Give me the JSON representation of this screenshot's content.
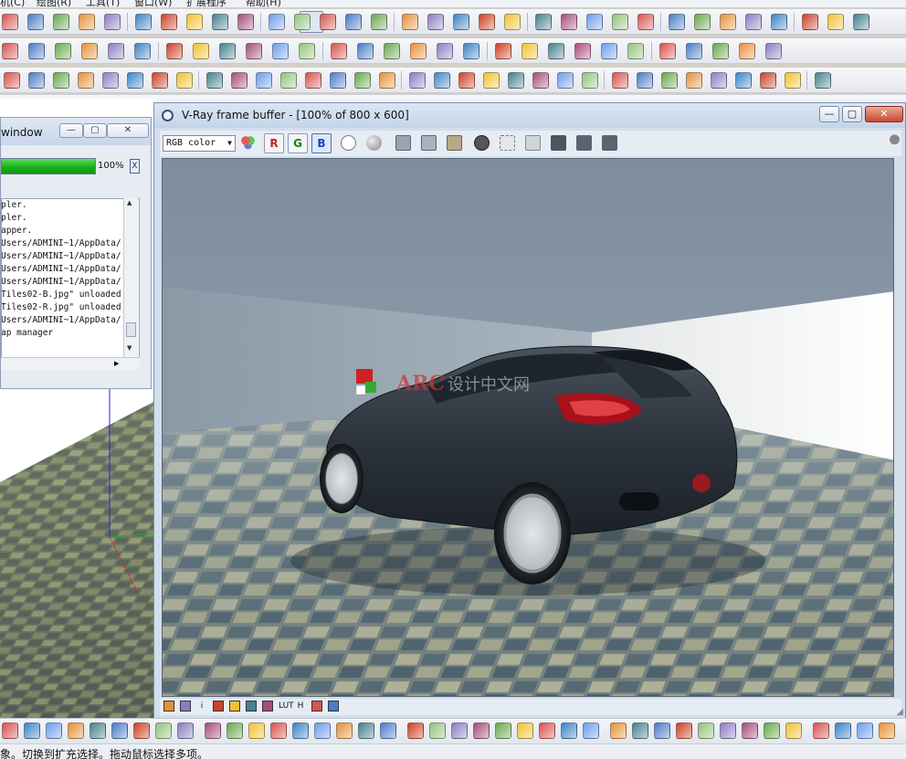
{
  "app": {
    "menu": [
      "机(C)",
      "绘图(R)",
      "工具(T)",
      "窗口(W)",
      "扩展程序",
      "帮助(H)"
    ]
  },
  "toolbars": {
    "row1": [
      "error-icon",
      "undo-icon",
      "redo-icon",
      "print-icon",
      "render-icon",
      "component-icon",
      "box-icon",
      "home-icon",
      "warehouse-icon",
      "house-icon",
      "shed-icon",
      "select-arrow-icon",
      "eraser-icon",
      "pencil-icon",
      "arc-icon",
      "rectangle-icon",
      "push-pull-icon",
      "rotate-icon",
      "move-icon",
      "refresh-icon",
      "scale-icon",
      "tape-icon",
      "text-label-icon",
      "paint-bucket-icon",
      "orbit-icon",
      "pan-hand-icon",
      "zoom-icon",
      "zoom-extents-icon",
      "book-icon",
      "car-icon",
      "globe-icon",
      "export-icon",
      "extension-icon"
    ],
    "row2": [
      "material-icon",
      "light-icon",
      "render-r-icon",
      "render-rt-icon",
      "render-br-icon",
      "help-icon",
      "tag-icon",
      "gem-icon",
      "sun-icon",
      "plant-icon",
      "tree-icon",
      "pause-icon",
      "frame-icon",
      "box-frame-icon",
      "mirror-icon",
      "circle-frame-icon",
      "dot-icon",
      "lamp-icon",
      "flag-icon",
      "bulb-icon",
      "spot-icon",
      "axis-icon",
      "arrows-icon",
      "transform-icon",
      "flip-icon",
      "grip-icon",
      "rotate-arrow-icon",
      "return-icon",
      "path-icon"
    ],
    "row3": [
      "solid-icon",
      "shaded-icon",
      "shape-icon",
      "box3d-icon",
      "folder-icon",
      "layer-icon",
      "window-grid-icon",
      "panel-icon",
      "lock-icon",
      "draw-icon",
      "shield-icon",
      "ds-icon",
      "wrench-icon",
      "image-icon",
      "cube-icon",
      "tools-icon",
      "pen-icon",
      "notepad-icon",
      "stamp-icon",
      "film-icon",
      "lens-icon",
      "wire-box-icon",
      "lattice-icon",
      "pyramid-icon",
      "person-icon",
      "shovel-icon",
      "terrain-icon",
      "bag-icon",
      "cube-yellow-icon",
      "box-outline-icon",
      "monument-icon",
      "tent-icon",
      "alien-icon"
    ],
    "row4": [
      "cube-cyan-icon",
      "cube-teal-icon",
      "grid-icon",
      "dimension-icon",
      "bracket-icon",
      "text-icon"
    ]
  },
  "progress_window": {
    "title": "window",
    "percent_label": "100%",
    "percent_value": 100,
    "expand_label": "X",
    "min_label": "—",
    "max_label": "▢",
    "close_label": "✕",
    "log": [
      "pler.",
      "pler.",
      "apper.",
      "Users/ADMINI~1/AppData/",
      "Users/ADMINI~1/AppData/",
      "Users/ADMINI~1/AppData/",
      "Users/ADMINI~1/AppData/",
      "Tiles02-B.jpg\" unloaded",
      "Tiles02-R.jpg\" unloaded",
      "Users/ADMINI~1/AppData/",
      "ap manager"
    ]
  },
  "vfb": {
    "title": "V-Ray frame buffer - [100% of 800 x 600]",
    "channel_select": "RGB color",
    "r_label": "R",
    "g_label": "G",
    "b_label": "B",
    "min_label": "—",
    "max_label": "▢",
    "close_label": "✕",
    "watermark_text": "ARC",
    "watermark_text_cn": "设计中文网",
    "status_icons": [
      "frame-stamp-icon",
      "history-icon",
      "info-icon",
      "levels-icon",
      "color-corrections-icon",
      "lens-effects-icon",
      "stereo-icon",
      "lut-icon",
      "hdr-icon",
      "ocio-icon",
      "compare-icon"
    ],
    "status_labels": [
      "",
      "",
      "i",
      "",
      "",
      "",
      "",
      "LUT",
      "H",
      "",
      ""
    ]
  },
  "status_bar": {
    "text": "象。切换到扩充选择。拖动鼠标选择多项。"
  },
  "colors": {
    "accent_green": "#18b118",
    "close_red": "#c9482f",
    "titlebar": "#c4d4e8"
  }
}
